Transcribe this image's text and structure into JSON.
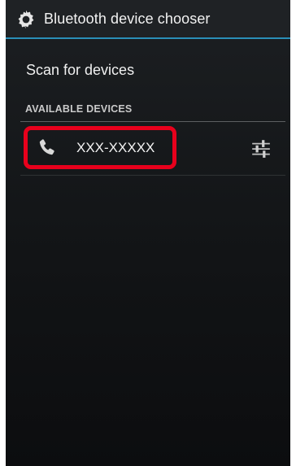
{
  "title_bar": {
    "icon": "gear-icon",
    "title": "Bluetooth device chooser"
  },
  "scan": {
    "label": "Scan for devices"
  },
  "available_devices": {
    "header": "AVAILABLE DEVICES",
    "items": [
      {
        "name": "XXX-XXXXX",
        "icon": "phone-icon",
        "settings_icon": "device-settings-icon"
      }
    ]
  },
  "annotation": {
    "color": "#e8001c"
  }
}
